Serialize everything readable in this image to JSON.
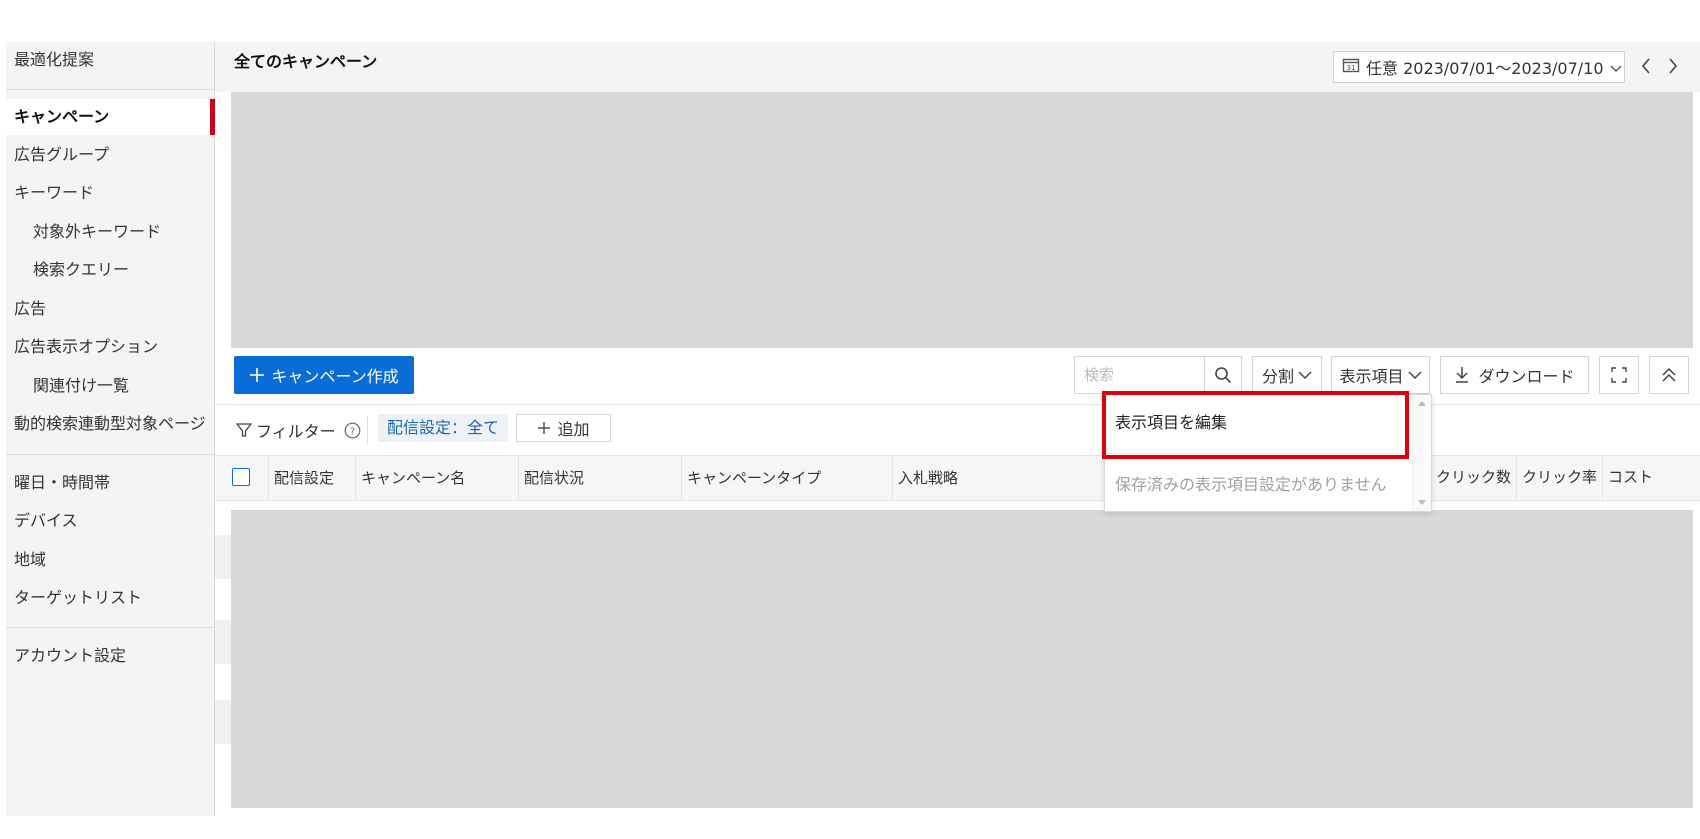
{
  "sidebar": {
    "items": [
      {
        "label": "最適化提案"
      },
      {
        "label": "キャンペーン"
      },
      {
        "label": "広告グループ"
      },
      {
        "label": "キーワード"
      },
      {
        "label": "対象外キーワード"
      },
      {
        "label": "検索クエリー"
      },
      {
        "label": "広告"
      },
      {
        "label": "広告表示オプション"
      },
      {
        "label": "関連付け一覧"
      },
      {
        "label": "動的検索連動型対象ページ"
      },
      {
        "label": "曜日・時間帯"
      },
      {
        "label": "デバイス"
      },
      {
        "label": "地域"
      },
      {
        "label": "ターゲットリスト"
      },
      {
        "label": "アカウント設定"
      }
    ]
  },
  "header": {
    "title": "全てのキャンペーン",
    "date_range": "任意 2023/07/01～2023/07/10"
  },
  "toolbar": {
    "create_label": "キャンペーン作成",
    "search_placeholder": "検索",
    "split_label": "分割",
    "columns_label": "表示項目",
    "download_label": "ダウンロード"
  },
  "filter": {
    "label": "フィルター",
    "chip": "配信設定：全て",
    "add_label": "追加"
  },
  "table": {
    "columns": [
      "配信設定",
      "キャンペーン名",
      "配信状況",
      "キャンペーンタイプ",
      "入札戦略",
      "クリック数",
      "クリック率",
      "コスト"
    ]
  },
  "dropdown": {
    "edit_label": "表示項目を編集",
    "empty_label": "保存済みの表示項目設定がありません"
  },
  "colors": {
    "primary": "#0a6cd6",
    "active_marker": "#d0021b",
    "highlight": "#e0000b",
    "placeholder_block": "#d8d8d8"
  }
}
